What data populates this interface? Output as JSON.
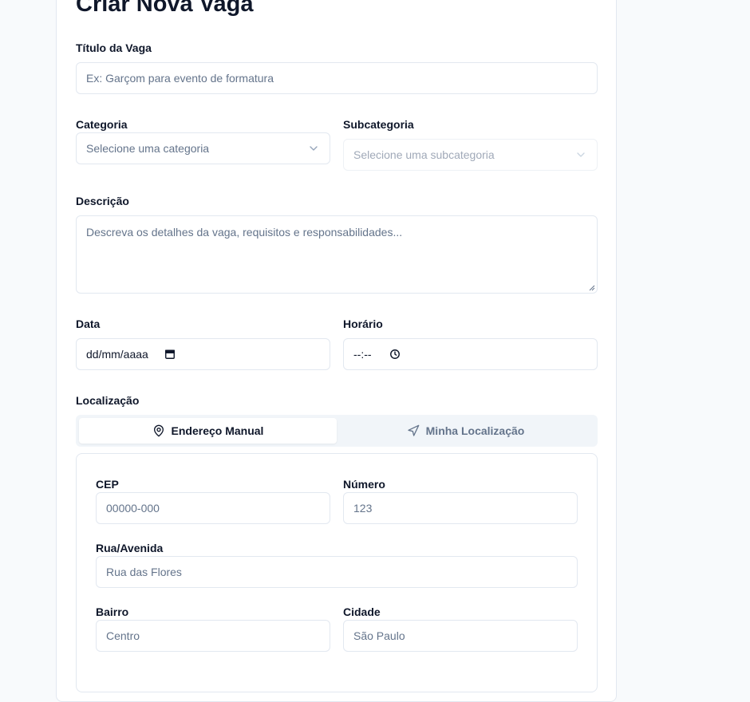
{
  "page": {
    "title": "Criar Nova Vaga"
  },
  "form": {
    "titulo": {
      "label": "Título da Vaga",
      "placeholder": "Ex: Garçom para evento de formatura"
    },
    "categoria": {
      "label": "Categoria",
      "value": "Selecione uma categoria"
    },
    "subcategoria": {
      "label": "Subcategoria",
      "value": "Selecione uma subcategoria"
    },
    "descricao": {
      "label": "Descrição",
      "placeholder": "Descreva os detalhes da vaga, requisitos e responsabilidades..."
    },
    "data": {
      "label": "Data",
      "value": "dd/mm/aaaa"
    },
    "horario": {
      "label": "Horário",
      "value": "--:--"
    },
    "localizacao": {
      "label": "Localização",
      "tabs": [
        {
          "label": "Endereço Manual",
          "icon": "map-pin-icon",
          "active": true
        },
        {
          "label": "Minha Localização",
          "icon": "navigation-icon",
          "active": false
        }
      ]
    },
    "endereco": {
      "cep": {
        "label": "CEP",
        "placeholder": "00000-000"
      },
      "numero": {
        "label": "Número",
        "placeholder": "123"
      },
      "rua": {
        "label": "Rua/Avenida",
        "placeholder": "Rua das Flores"
      },
      "bairro": {
        "label": "Bairro",
        "placeholder": "Centro"
      },
      "cidade": {
        "label": "Cidade",
        "placeholder": "São Paulo"
      }
    }
  },
  "colors": {
    "text": "#0f172a",
    "muted": "#64748b",
    "border": "#e2e8f0",
    "tab_bg": "#f1f5f9"
  }
}
